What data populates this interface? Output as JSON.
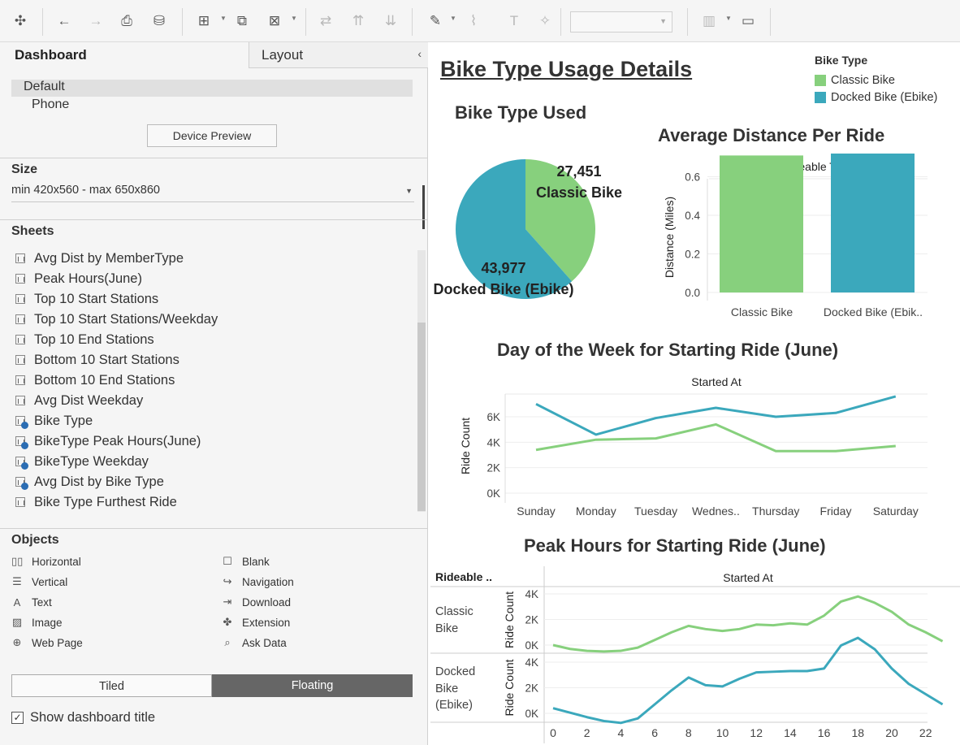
{
  "toolbar": {
    "buttons": [
      {
        "name": "tableau-logo-icon",
        "glyph": "✣"
      },
      {
        "name": "undo-icon",
        "glyph": "←"
      },
      {
        "name": "redo-icon",
        "glyph": "→"
      },
      {
        "name": "save-icon",
        "glyph": "⎙"
      },
      {
        "name": "new-data-source-icon",
        "glyph": "⛁"
      },
      {
        "name": "new-worksheet-icon",
        "glyph": "⊞"
      },
      {
        "name": "duplicate-sheet-icon",
        "glyph": "⧉"
      },
      {
        "name": "clear-sheet-icon",
        "glyph": "⊠"
      },
      {
        "name": "swap-icon",
        "glyph": "⇄"
      },
      {
        "name": "sort-ascending-icon",
        "glyph": "⇈"
      },
      {
        "name": "sort-descending-icon",
        "glyph": "⇊"
      },
      {
        "name": "highlight-icon",
        "glyph": "✎"
      },
      {
        "name": "attach-icon",
        "glyph": "⌇"
      },
      {
        "name": "text-label-icon",
        "glyph": "T"
      },
      {
        "name": "pin-icon",
        "glyph": "✧"
      },
      {
        "name": "show-me-icon",
        "glyph": "▥"
      },
      {
        "name": "presentation-mode-icon",
        "glyph": "▭"
      }
    ]
  },
  "left_pane": {
    "tabs": {
      "dashboard": "Dashboard",
      "layout": "Layout"
    },
    "collapse_glyph": "‹",
    "devices": [
      "Default",
      "Phone"
    ],
    "device_preview_label": "Device Preview",
    "size_title": "Size",
    "size_value": "min 420x560 - max 650x860",
    "sheets_title": "Sheets",
    "sheets": [
      {
        "label": "Avg Dist by MemberType",
        "used": false
      },
      {
        "label": "Peak Hours(June)",
        "used": false
      },
      {
        "label": "Top 10 Start Stations",
        "used": false
      },
      {
        "label": "Top 10 Start Stations/Weekday",
        "used": false
      },
      {
        "label": "Top 10 End Stations",
        "used": false
      },
      {
        "label": "Bottom 10 Start Stations",
        "used": false
      },
      {
        "label": "Bottom 10 End Stations",
        "used": false
      },
      {
        "label": "Avg Dist Weekday",
        "used": false
      },
      {
        "label": "Bike Type",
        "used": true
      },
      {
        "label": "BikeType Peak Hours(June)",
        "used": true
      },
      {
        "label": "BikeType Weekday",
        "used": true
      },
      {
        "label": "Avg Dist by Bike Type",
        "used": true
      },
      {
        "label": "Bike Type Furthest Ride",
        "used": false
      }
    ],
    "objects_title": "Objects",
    "objects": [
      {
        "label": "Horizontal",
        "icon": "horizontal-container-icon",
        "glyph": "▯▯"
      },
      {
        "label": "Blank",
        "icon": "blank-icon",
        "glyph": "☐"
      },
      {
        "label": "Vertical",
        "icon": "vertical-container-icon",
        "glyph": "☰"
      },
      {
        "label": "Navigation",
        "icon": "navigation-icon",
        "glyph": "↪"
      },
      {
        "label": "Text",
        "icon": "text-icon",
        "glyph": "A"
      },
      {
        "label": "Download",
        "icon": "download-icon",
        "glyph": "⇥"
      },
      {
        "label": "Image",
        "icon": "image-icon",
        "glyph": "▨"
      },
      {
        "label": "Extension",
        "icon": "extension-icon",
        "glyph": "✤"
      },
      {
        "label": "Web Page",
        "icon": "web-page-icon",
        "glyph": "⊕"
      },
      {
        "label": "Ask Data",
        "icon": "ask-data-icon",
        "glyph": "⌕"
      }
    ],
    "layout_modes": {
      "tiled": "Tiled",
      "floating": "Floating",
      "selected": "Floating"
    },
    "show_title_label": "Show dashboard title",
    "show_title_checked": true
  },
  "dashboard": {
    "title": "Bike Type Usage Details",
    "legend_title": "Bike Type",
    "colors": {
      "classic": "#87d07d",
      "docked": "#3ba8bc"
    },
    "legend": [
      "Classic Bike",
      "Docked Bike (Ebike)"
    ],
    "pie_title": "Bike Type Used",
    "bar_title": "Average Distance Per Ride",
    "week_title": "Day of the Week for Starting Ride (June)",
    "peak_title": "Peak Hours for Starting Ride (June)"
  },
  "chart_data": [
    {
      "type": "pie",
      "title": "Bike Type Used",
      "categories": [
        "Classic Bike",
        "Docked Bike (Ebike)"
      ],
      "values": [
        27451,
        43977
      ],
      "labels": [
        "27,451",
        "43,977"
      ]
    },
    {
      "type": "bar",
      "title": "Average Distance Per Ride",
      "header": "Rideable Type",
      "categories": [
        "Classic Bike",
        "Docked Bike (Ebik.."
      ],
      "values": [
        0.71,
        0.72
      ],
      "ylabel": "Distance (Miles)",
      "ylim": [
        0,
        0.72
      ],
      "yticks": [
        "0.0",
        "0.2",
        "0.4",
        "0.6"
      ]
    },
    {
      "type": "line",
      "title": "Day of the Week for Starting Ride (June)",
      "header": "Started At",
      "x": [
        "Sunday",
        "Monday",
        "Tuesday",
        "Wednes..",
        "Thursday",
        "Friday",
        "Saturday"
      ],
      "series": [
        {
          "name": "Classic Bike",
          "values": [
            3400,
            4200,
            4300,
            5400,
            3300,
            3300,
            3700
          ]
        },
        {
          "name": "Docked Bike (Ebike)",
          "values": [
            7000,
            4600,
            5900,
            6700,
            6000,
            6300,
            7600
          ]
        }
      ],
      "ylabel": "Ride Count",
      "ylim": [
        0,
        7600
      ],
      "yticks": [
        "0K",
        "2K",
        "4K",
        "6K"
      ]
    },
    {
      "type": "line",
      "title": "Peak Hours for Starting Ride (June)",
      "header_row": "Rideable ..",
      "header": "Started At",
      "rows": [
        "Classic Bike",
        "Docked Bike (Ebike)"
      ],
      "x": [
        0,
        1,
        2,
        3,
        4,
        5,
        6,
        7,
        8,
        9,
        10,
        11,
        12,
        13,
        14,
        15,
        16,
        17,
        18,
        19,
        20,
        21,
        22,
        23
      ],
      "xticks": [
        "0",
        "2",
        "4",
        "6",
        "8",
        "10",
        "12",
        "14",
        "16",
        "18",
        "20",
        "22"
      ],
      "series": [
        {
          "name": "Classic Bike",
          "values": [
            0,
            -300,
            -450,
            -500,
            -450,
            -200,
            400,
            1000,
            1500,
            1250,
            1100,
            1250,
            1600,
            1550,
            1700,
            1600,
            2300,
            3400,
            3800,
            3300,
            2600,
            1600,
            1000,
            300
          ]
        },
        {
          "name": "Docked Bike (Ebike)",
          "values": [
            400,
            50,
            -300,
            -600,
            -750,
            -400,
            700,
            1800,
            2800,
            2200,
            2100,
            2700,
            3200,
            3250,
            3300,
            3300,
            3500,
            5300,
            5900,
            5000,
            3500,
            2300,
            1500,
            700
          ]
        }
      ],
      "ylabel": "Ride Count",
      "yticks": [
        "0K",
        "2K",
        "4K"
      ]
    }
  ]
}
